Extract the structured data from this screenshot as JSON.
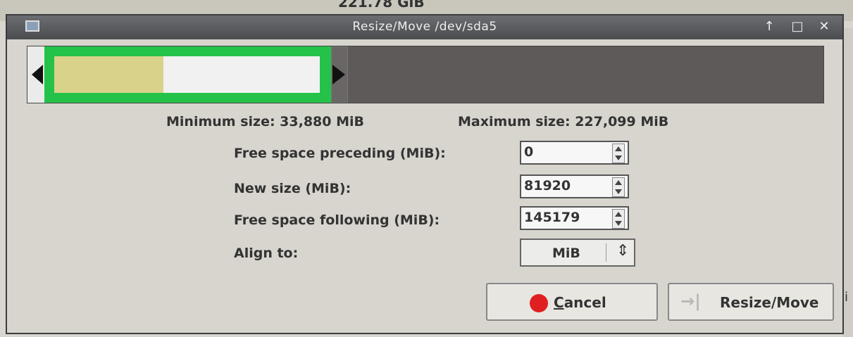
{
  "background": {
    "partition_size_text": "221.78 GiB",
    "right_char": "i"
  },
  "window": {
    "title": "Resize/Move /dev/sda5",
    "buttons": {
      "up": "↑",
      "maximize": "□",
      "close": "✕"
    }
  },
  "partition_bar": {
    "selected_fraction": 0.36,
    "used_fraction_of_selected": 0.41,
    "colors": {
      "selected": "#25c24a",
      "used": "#d8d28a",
      "free_unallocated": "#5f5a5a"
    }
  },
  "sizes": {
    "minimum": "Minimum size: 33,880 MiB",
    "maximum": "Maximum size: 227,099 MiB"
  },
  "fields": {
    "free_preceding": {
      "label": "Free space preceding (MiB):",
      "value": "0"
    },
    "new_size": {
      "label": "New size (MiB):",
      "value": "81920"
    },
    "free_following": {
      "label": "Free space following (MiB):",
      "value": "145179"
    },
    "align": {
      "label": "Align to:",
      "value": "MiB"
    }
  },
  "buttons": {
    "cancel": {
      "underlined": "C",
      "rest": "ancel"
    },
    "resize": {
      "label": "Resize/Move",
      "icon": "→|"
    }
  }
}
